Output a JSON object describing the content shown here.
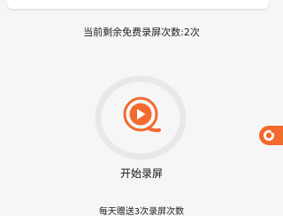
{
  "header": {
    "free_count_text": "当前剩余免费录屏次数:2次"
  },
  "record": {
    "button_label": "开始录屏",
    "icon": "video-play-icon",
    "accent_color": "#f26a2e",
    "ring_color": "#e8e8e8"
  },
  "footer": {
    "daily_bonus_text": "每天赠送3次录屏次数"
  },
  "floating": {
    "icon": "camera-record-icon",
    "color": "#f26a2e"
  }
}
